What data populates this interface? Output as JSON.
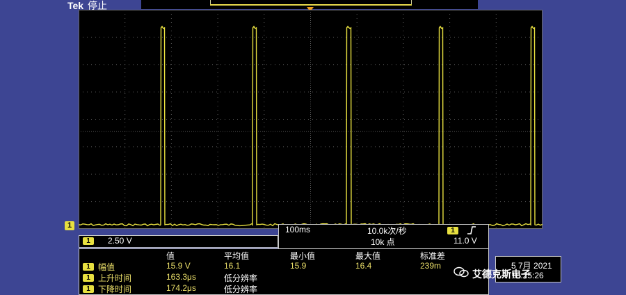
{
  "header": {
    "brand": "Tek",
    "run_state": "停止"
  },
  "colors": {
    "trace": "#e8e040",
    "grid": "#5a5a5a",
    "background": "#3d4593"
  },
  "channel": {
    "marker": "1"
  },
  "vertical": {
    "channel": "1",
    "scale": "2.50 V"
  },
  "timebase": {
    "time_per_div": "100ms",
    "sample_rate": "10.0k次/秒",
    "record_length": "10k 点",
    "trigger_channel": "1",
    "trigger_slope_icon": "rising-edge-icon",
    "trigger_level": "11.0 V"
  },
  "measurements": {
    "headers": [
      "值",
      "平均值",
      "最小值",
      "最大值",
      "标准差"
    ],
    "rows": [
      {
        "channel": "1",
        "name": "幅值",
        "value": "15.9 V",
        "mean": "16.1",
        "min": "15.9",
        "max": "16.4",
        "std": "239m"
      },
      {
        "channel": "1",
        "name": "上升时间",
        "value": "163.3μs",
        "mean": "低分辨率",
        "min": "",
        "max": "",
        "std": ""
      },
      {
        "channel": "1",
        "name": "下降时间",
        "value": "174.2μs",
        "mean": "低分辨率",
        "min": "",
        "max": "",
        "std": ""
      }
    ]
  },
  "date": {
    "line1": "5 7月  2021",
    "line2": "18:25:26"
  },
  "watermark": {
    "text": "艾德克斯电子",
    "icon": "wechat-icon"
  }
}
